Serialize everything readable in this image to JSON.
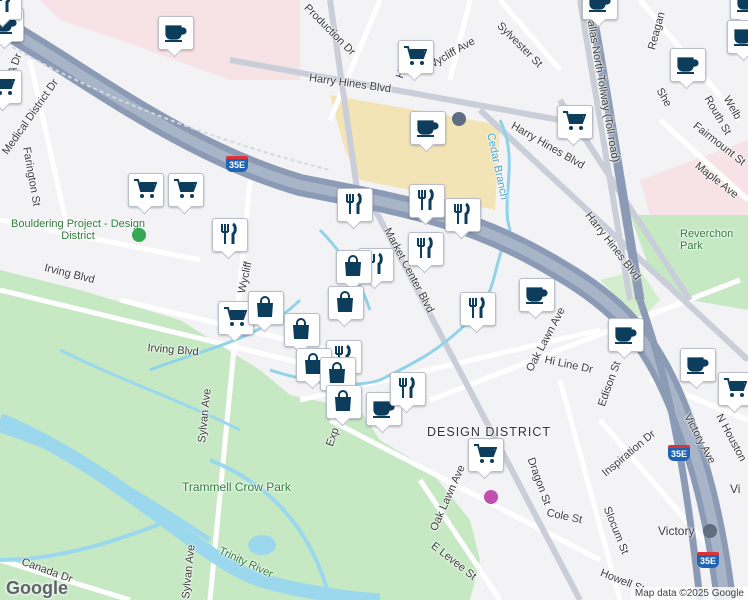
{
  "map": {
    "attribution": "Map data ©2025 Google",
    "logo": "Google",
    "highway_shields": [
      "35E",
      "35E",
      "35E"
    ],
    "labels": {
      "design_district": "DESIGN DISTRICT",
      "trammell_crow_park": "Trammell Crow Park",
      "trinity_river": "Trinity River",
      "bouldering_project": "Bouldering Project - Design District",
      "reverchon_park": "Reverchon Park",
      "victory": "Victory",
      "vi": "Vi",
      "harry_hines_1": "Harry Hines Blvd",
      "harry_hines_2": "Harry Hines Blvd",
      "harry_hines_3": "Harry Hines Blvd",
      "dallas_north_tollway": "Dallas North Tollway (Toll road)",
      "medical_district": "Medical District Dr",
      "farington": "Farington St",
      "irving_1": "Irving Blvd",
      "irving_2": "Irving Blvd",
      "wycliff_ave_1": "Wycliff Ave",
      "wycliff_ave_2": "Wycliff",
      "sylvester": "Sylvester St",
      "production": "Production Dr",
      "market_center": "Market Center Blvd",
      "cedar_branch": "Cedar Branch",
      "oak_lawn_1": "Oak Lawn Ave",
      "oak_lawn_2": "Oak Lawn Ave",
      "hi_line": "Hi Line Dr",
      "edison": "Edison St",
      "inspiration": "Inspiration Dr",
      "dragon": "Dragon St",
      "cole": "Cole St",
      "slocum": "Slocum St",
      "howell": "Howell St",
      "e_levee": "E Levee St",
      "canada": "Canada Dr",
      "sylvan": "Sylvan Ave",
      "sylvan_2": "Sylvan Ave",
      "maple": "Maple Ave",
      "fairmount": "Fairmount St",
      "routh": "Routh St",
      "victory_ave": "Victory Ave",
      "n_houston": "N Houston",
      "reagan": "Reagan",
      "welborn": "Welb",
      "she": "She",
      "expo": "Exp",
      "ho": "Ho",
      "a_dr": "A Dr"
    },
    "markers": [
      {
        "type": "cafe",
        "name": "cafe-marker"
      },
      {
        "type": "cafe",
        "name": "cafe-marker"
      },
      {
        "type": "cafe",
        "name": "cafe-marker"
      },
      {
        "type": "cafe",
        "name": "cafe-marker"
      },
      {
        "type": "cafe",
        "name": "cafe-marker"
      },
      {
        "type": "cafe",
        "name": "cafe-marker"
      },
      {
        "type": "cafe",
        "name": "cafe-marker"
      },
      {
        "type": "cafe",
        "name": "cafe-marker"
      },
      {
        "type": "cafe",
        "name": "cafe-marker"
      },
      {
        "type": "cafe",
        "name": "cafe-marker"
      },
      {
        "type": "cafe",
        "name": "cafe-marker"
      },
      {
        "type": "shopping",
        "name": "shopping-cart-marker"
      },
      {
        "type": "shopping",
        "name": "shopping-cart-marker"
      },
      {
        "type": "shopping",
        "name": "shopping-cart-marker"
      },
      {
        "type": "shopping",
        "name": "shopping-cart-marker"
      },
      {
        "type": "shopping",
        "name": "shopping-cart-marker"
      },
      {
        "type": "shopping",
        "name": "shopping-cart-marker"
      },
      {
        "type": "shopping",
        "name": "shopping-cart-marker"
      },
      {
        "type": "shopping",
        "name": "shopping-cart-marker"
      },
      {
        "type": "restaurant",
        "name": "restaurant-marker"
      },
      {
        "type": "restaurant",
        "name": "restaurant-marker"
      },
      {
        "type": "restaurant",
        "name": "restaurant-marker"
      },
      {
        "type": "restaurant",
        "name": "restaurant-marker"
      },
      {
        "type": "restaurant",
        "name": "restaurant-marker"
      },
      {
        "type": "restaurant",
        "name": "restaurant-marker"
      },
      {
        "type": "restaurant",
        "name": "restaurant-marker"
      },
      {
        "type": "restaurant",
        "name": "restaurant-marker"
      },
      {
        "type": "restaurant",
        "name": "restaurant-marker"
      },
      {
        "type": "restaurant",
        "name": "restaurant-marker"
      },
      {
        "type": "bag",
        "name": "shopping-bag-marker"
      },
      {
        "type": "bag",
        "name": "shopping-bag-marker"
      },
      {
        "type": "bag",
        "name": "shopping-bag-marker"
      },
      {
        "type": "bag",
        "name": "shopping-bag-marker"
      },
      {
        "type": "bag",
        "name": "shopping-bag-marker"
      },
      {
        "type": "bag",
        "name": "shopping-bag-marker"
      },
      {
        "type": "bag",
        "name": "shopping-bag-marker"
      }
    ],
    "colors": {
      "marker_icon": "#0d3d5c",
      "highway": "#8b9bb5",
      "park": "#c8ebc4",
      "water": "#9bd8ee",
      "campus": "#f4e4b4",
      "shield": "#1f63b5"
    }
  }
}
